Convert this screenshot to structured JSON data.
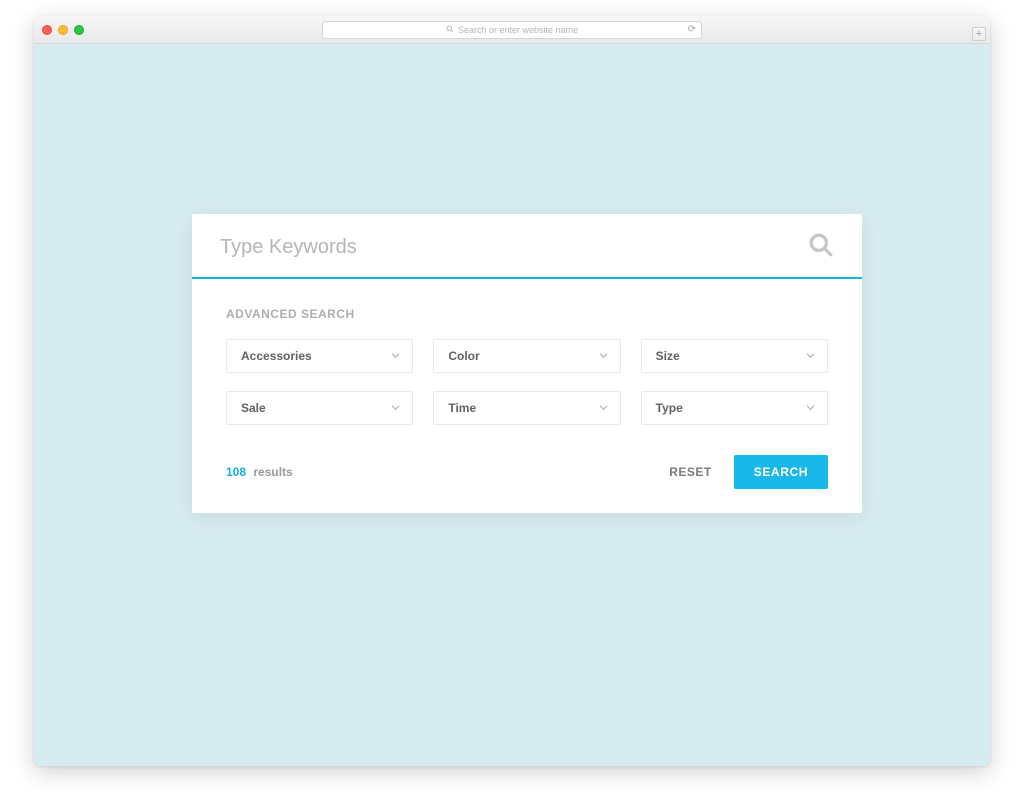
{
  "browser": {
    "url_placeholder": "Search or enter website name"
  },
  "search": {
    "placeholder": "Type Keywords",
    "advanced_label": "ADVANCED SEARCH",
    "filters": {
      "accessories": "Accessories",
      "color": "Color",
      "size": "Size",
      "sale": "Sale",
      "time": "Time",
      "type": "Type"
    },
    "results_count": "108",
    "results_label": "results",
    "reset_label": "RESET",
    "search_label": "SEARCH"
  }
}
